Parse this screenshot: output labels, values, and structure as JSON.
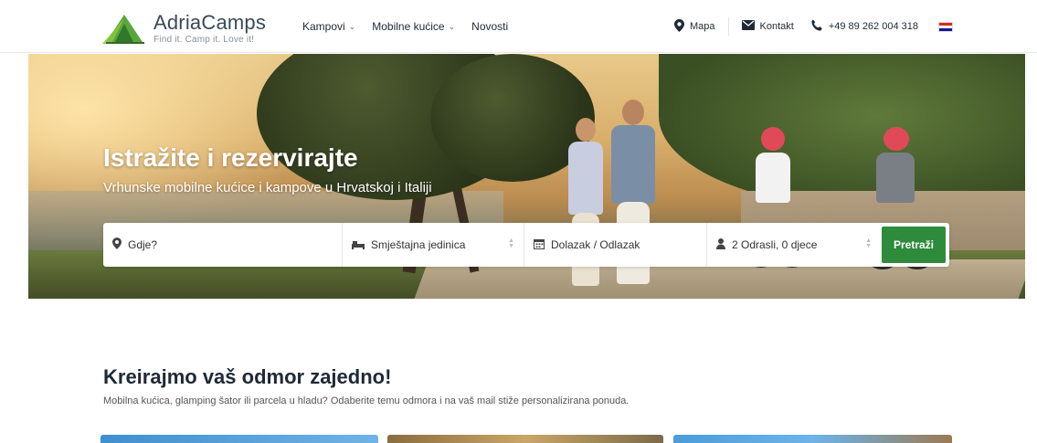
{
  "header": {
    "logo": {
      "title": "AdriaCamps",
      "tagline": "Find it. Camp it. Love it!"
    },
    "nav": [
      {
        "label": "Kampovi",
        "has_dropdown": true
      },
      {
        "label": "Mobilne kućice",
        "has_dropdown": true
      },
      {
        "label": "Novosti",
        "has_dropdown": false
      }
    ],
    "right": {
      "map_label": "Mapa",
      "contact_label": "Kontakt",
      "phone": "+49 89 262 004 318",
      "language_flag": "croatian-flag"
    }
  },
  "hero": {
    "title": "Istražite i rezervirajte",
    "subtitle": "Vrhunske mobilne kućice i kampove u Hrvatskoj i Italiji"
  },
  "search": {
    "where_placeholder": "Gdje?",
    "unit_label": "Smještajna jedinica",
    "dates_label": "Dolazak / Odlazak",
    "guests_label": "2 Odrasli, 0 djece",
    "submit_label": "Pretraži"
  },
  "section": {
    "title": "Kreirajmo vaš odmor zajedno!",
    "subtitle": "Mobilna kućica, glamping šator ili parcela u hladu? Odaberite temu odmora i na vaš mail stiže personalizirana ponuda."
  },
  "colors": {
    "accent_green": "#2e8b3c",
    "logo_green": "#5aa63c",
    "text_dark": "#1f2937"
  }
}
